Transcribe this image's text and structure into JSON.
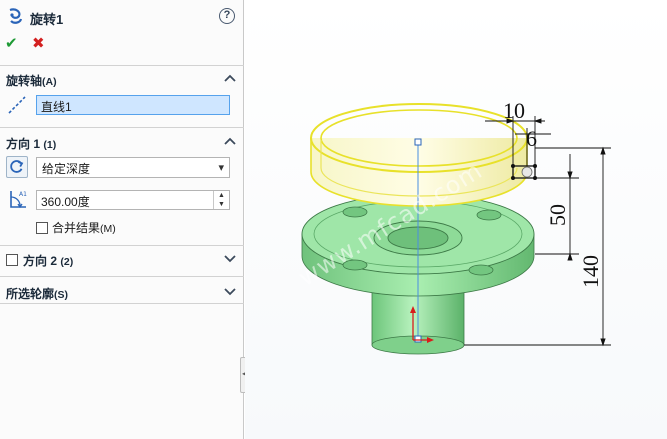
{
  "feature": {
    "title": "旋转1",
    "help_label": "?"
  },
  "actions": {
    "ok_icon": "checkmark-icon",
    "cancel_icon": "x-icon"
  },
  "axis_group": {
    "label": "旋转轴",
    "shortcut": "(A)",
    "selection": "直线1"
  },
  "direction1": {
    "label": "方向 1",
    "shortcut": "(1)",
    "end_condition": "给定深度",
    "angle": "360.00度",
    "merge_label": "合并结果",
    "merge_shortcut": "(M)",
    "merge_checked": false
  },
  "direction2": {
    "label": "方向 2",
    "shortcut": "(2)",
    "checked": false
  },
  "selected_contours": {
    "label": "所选轮廓",
    "shortcut": "(S)"
  },
  "dimensions": {
    "d10": "10",
    "d6": "6",
    "d50": "50",
    "d140": "140"
  },
  "watermark": "www.mfcad.com",
  "colors": {
    "part_green": "#8fe09a",
    "preview_yellow": "#f4f27a",
    "selection_blue": "#cfe6ff"
  }
}
